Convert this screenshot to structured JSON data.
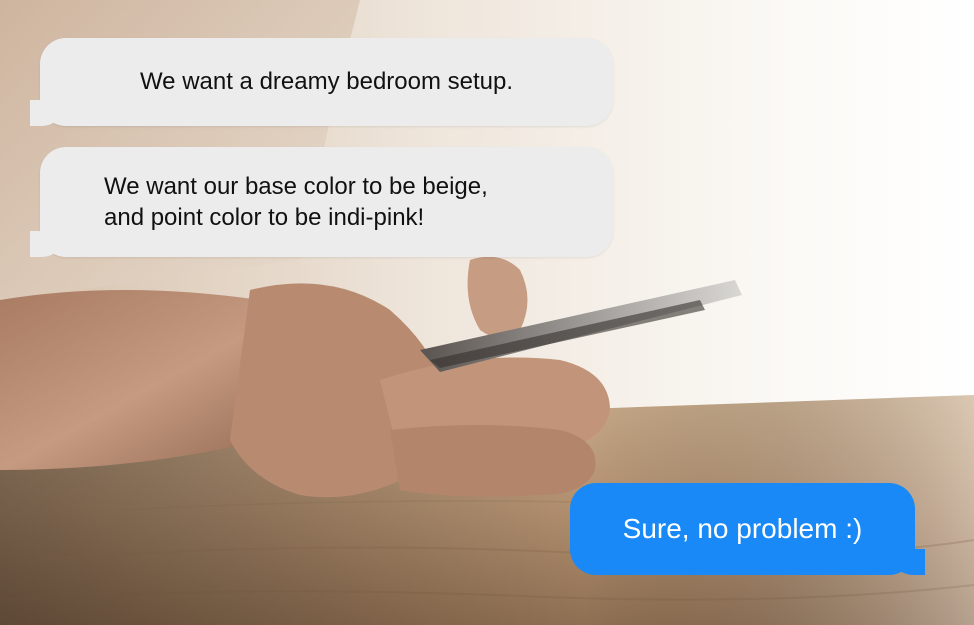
{
  "conversation": {
    "messages": [
      {
        "direction": "incoming",
        "text": "We want a dreamy bedroom setup."
      },
      {
        "direction": "incoming",
        "lines": [
          "We want our base color to be beige,",
          "and point color to be indi-pink!"
        ]
      },
      {
        "direction": "outgoing",
        "text": "Sure, no problem :)"
      }
    ]
  },
  "colors": {
    "incoming_bubble": "#ececec",
    "outgoing_bubble": "#1889f6",
    "outgoing_text": "#ffffff"
  }
}
